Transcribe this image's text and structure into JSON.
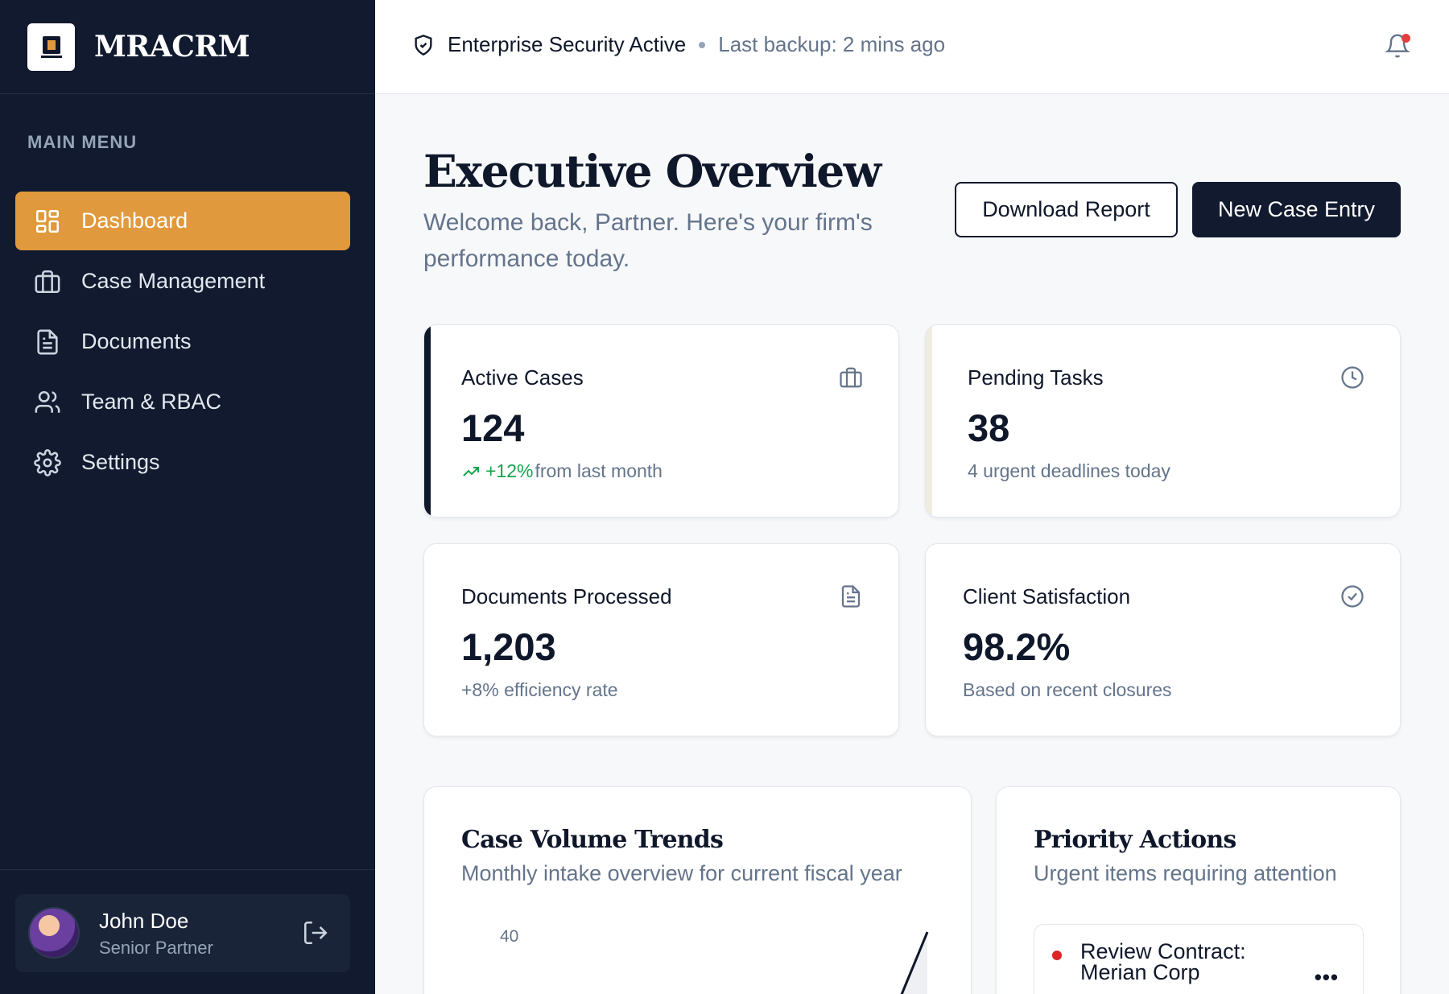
{
  "app": {
    "name": "MRACRM"
  },
  "sidebar": {
    "menu_heading": "MAIN MENU",
    "items": [
      {
        "label": "Dashboard",
        "icon": "dashboard-icon",
        "active": true
      },
      {
        "label": "Case Management",
        "icon": "briefcase-icon",
        "active": false
      },
      {
        "label": "Documents",
        "icon": "document-icon",
        "active": false
      },
      {
        "label": "Team & RBAC",
        "icon": "users-icon",
        "active": false
      },
      {
        "label": "Settings",
        "icon": "gear-icon",
        "active": false
      }
    ],
    "user": {
      "name": "John Doe",
      "role": "Senior Partner"
    }
  },
  "topbar": {
    "security_status": "Enterprise Security Active",
    "backup_status": "Last backup: 2 mins ago"
  },
  "header": {
    "title": "Executive Overview",
    "subtitle": "Welcome back, Partner. Here's your firm's performance today.",
    "download_label": "Download Report",
    "new_case_label": "New Case Entry"
  },
  "stats": [
    {
      "label": "Active Cases",
      "value": "124",
      "trend": "+12%",
      "sub": "from last month",
      "icon": "briefcase-icon"
    },
    {
      "label": "Pending Tasks",
      "value": "38",
      "sub": "4 urgent deadlines today",
      "icon": "clock-icon"
    },
    {
      "label": "Documents Processed",
      "value": "1,203",
      "sub": "+8% efficiency rate",
      "icon": "document-icon"
    },
    {
      "label": "Client Satisfaction",
      "value": "98.2%",
      "sub": "Based on recent closures",
      "icon": "check-circle-icon"
    }
  ],
  "case_trends": {
    "title": "Case Volume Trends",
    "subtitle": "Monthly intake overview for current fiscal year",
    "y_tick_top": "40"
  },
  "priority_actions": {
    "title": "Priority Actions",
    "subtitle": "Urgent items requiring attention",
    "items": [
      {
        "label": "Review Contract: Merian Corp"
      }
    ]
  },
  "colors": {
    "sidebar_bg": "#111a2e",
    "accent": "#e09a3d",
    "positive": "#16a34a",
    "alert": "#dc2626"
  }
}
